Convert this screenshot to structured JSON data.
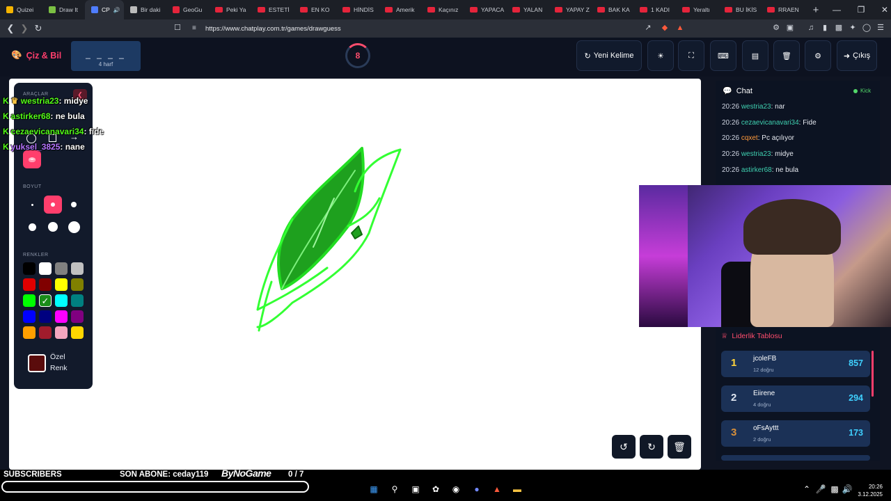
{
  "browser": {
    "tabs": [
      {
        "label": "Quizei",
        "icon": "quiz-favicon",
        "color": "#f5b400"
      },
      {
        "label": "Draw It",
        "icon": "draw-favicon",
        "color": "#7bc043"
      },
      {
        "label": "CP",
        "icon": "chatplay-favicon",
        "color": "#4f7dff",
        "active": true
      },
      {
        "label": "Bir daki",
        "icon": "globe-favicon",
        "color": "#bbbbbb"
      },
      {
        "label": "GeoGu",
        "icon": "map-pin-favicon",
        "color": "#e5243b"
      },
      {
        "label": "Peki Ya",
        "icon": "youtube-favicon",
        "color": "#e5243b"
      },
      {
        "label": "ESTETİ",
        "icon": "youtube-favicon",
        "color": "#e5243b"
      },
      {
        "label": "EN KO",
        "icon": "youtube-favicon",
        "color": "#e5243b"
      },
      {
        "label": "HİNDİS",
        "icon": "youtube-favicon",
        "color": "#e5243b"
      },
      {
        "label": "Amerik",
        "icon": "youtube-favicon",
        "color": "#e5243b"
      },
      {
        "label": "Kaçınız",
        "icon": "youtube-favicon",
        "color": "#e5243b"
      },
      {
        "label": "YAPACA",
        "icon": "youtube-favicon",
        "color": "#e5243b"
      },
      {
        "label": "YALAN",
        "icon": "youtube-favicon",
        "color": "#e5243b"
      },
      {
        "label": "YAPAY Z",
        "icon": "youtube-favicon",
        "color": "#e5243b"
      },
      {
        "label": "BAK KA",
        "icon": "youtube-favicon",
        "color": "#e5243b"
      },
      {
        "label": "1 KADI",
        "icon": "youtube-favicon",
        "color": "#e5243b"
      },
      {
        "label": "Yeraltı",
        "icon": "youtube-favicon",
        "color": "#e5243b"
      },
      {
        "label": "BU İKİS",
        "icon": "youtube-favicon",
        "color": "#e5243b"
      },
      {
        "label": "RRAEN",
        "icon": "youtube-favicon",
        "color": "#e5243b"
      }
    ],
    "new_tab": "+",
    "url": "https://www.chatplay.com.tr/games/drawguess"
  },
  "app": {
    "brand": "Çiz & Bil",
    "word_mask": "_ _ _ _",
    "word_length": "4 harf",
    "timer": "8",
    "new_word_label": "Yeni Kelime",
    "exit_label": "Çıkış"
  },
  "tools": {
    "tools_label": "ARAÇLAR",
    "size_label": "BOYUT",
    "colors_label": "RENKLER",
    "custom_color_label": "Özel Renk",
    "custom_color": "#5a0c0c",
    "selected_color": "#1a8c1a",
    "palette": [
      "#000000",
      "#ffffff",
      "#808080",
      "#c0c0c0",
      "#e00000",
      "#800000",
      "#ffff00",
      "#808000",
      "#00ff00",
      "#1a8c1a",
      "#00ffff",
      "#008080",
      "#0000ff",
      "#000080",
      "#ff00ff",
      "#800080",
      "#ff9f00",
      "#a01c2c",
      "#f4a6c0",
      "#ffd700"
    ]
  },
  "overlay_chat": [
    {
      "user": "westria23",
      "text": ": midye",
      "color": "#53fc18",
      "badge": true
    },
    {
      "user": "astirker68",
      "text": ": ne bula",
      "color": "#53fc18"
    },
    {
      "user": "cezaevicanavari34",
      "text": ": fide",
      "color": "#53fc18"
    },
    {
      "user": "yuksel_3825",
      "text": ": nane",
      "color": "#b574ff"
    }
  ],
  "chat": {
    "title": "Chat",
    "platform": "Kick",
    "messages": [
      {
        "time": "20:26",
        "user": "westria23",
        "text": ": nar",
        "color": "#3fd0b0"
      },
      {
        "time": "20:26",
        "user": "cezaevicanavari34",
        "text": ": Fide",
        "color": "#3fd0b0"
      },
      {
        "time": "20:26",
        "user": "cqxet",
        "text": ": Pc açılıyor",
        "color": "#ff9a3c"
      },
      {
        "time": "20:26",
        "user": "westria23",
        "text": ": midye",
        "color": "#3fd0b0"
      },
      {
        "time": "20:26",
        "user": "astirker68",
        "text": ": ne bula",
        "color": "#3fd0b0"
      }
    ]
  },
  "leaderboard": {
    "title": "Liderlik Tablosu",
    "rows": [
      {
        "rank": "1",
        "name": "jcoleFB",
        "sub": "12 doğru",
        "score": "857",
        "rank_color": "#ffd43b"
      },
      {
        "rank": "2",
        "name": "Eiirene",
        "sub": "4 doğru",
        "score": "294",
        "rank_color": "#dfe6f0"
      },
      {
        "rank": "3",
        "name": "oFsAyttt",
        "sub": "2 doğru",
        "score": "173",
        "rank_color": "#d9903a"
      }
    ]
  },
  "stream_overlay": {
    "subscribers_label": "SUBSCRIBERS",
    "last_sub": "SON ABONE: ceday119",
    "sponsor": "ByNoGame",
    "sub_goal": "0  / 7"
  },
  "taskbar": {
    "time": "20:26",
    "date": "3.12.2025"
  }
}
